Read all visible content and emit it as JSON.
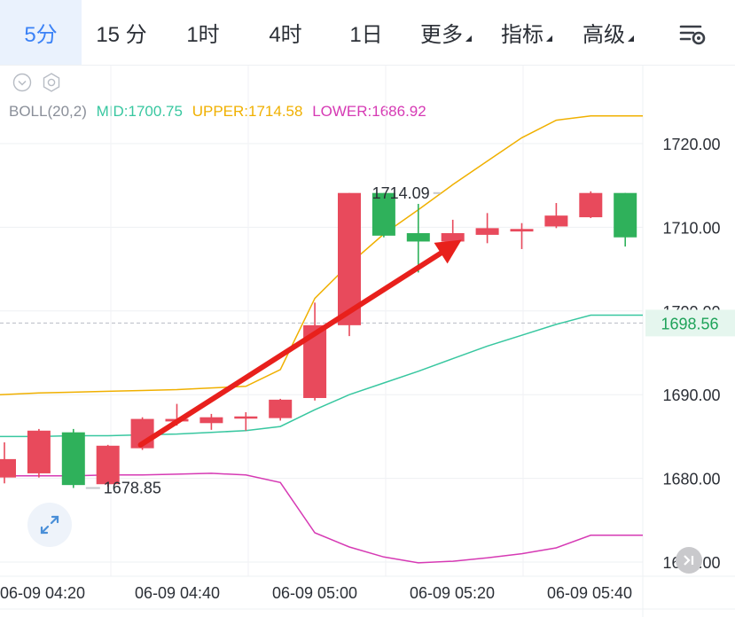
{
  "tabs": [
    {
      "label": "5分",
      "active": true
    },
    {
      "label": "15 分",
      "active": false
    },
    {
      "label": "1时",
      "active": false
    },
    {
      "label": "4时",
      "active": false
    },
    {
      "label": "1日",
      "active": false
    },
    {
      "label": "更多",
      "active": false,
      "dropdown": true
    },
    {
      "label": "指标",
      "active": false,
      "dropdown": true
    },
    {
      "label": "高级",
      "active": false,
      "dropdown": true
    }
  ],
  "toolbar": {
    "settings_icon": "chart-settings-icon"
  },
  "chart_controls": {
    "collapse_icon": "chevron-down-circle-icon",
    "indicator_settings_icon": "hexagon-gear-icon",
    "expand_icon": "expand-arrows-icon",
    "scroll_icon": "scroll-end-icon"
  },
  "indicator": {
    "name": "BOLL(20,2)",
    "mid_label": "MID:1700.75",
    "upper_label": "UPPER:1714.58",
    "lower_label": "LOWER:1686.92"
  },
  "colors": {
    "up": "#e84a5c",
    "down": "#2fb15b",
    "mid": "#38c7a0",
    "upper": "#f0b000",
    "lower": "#d63ab4",
    "arrow": "#e8201c",
    "accent": "#3b82f6"
  },
  "chart_data": {
    "type": "candlestick",
    "y_axis": {
      "range": [
        1666.5,
        1724
      ],
      "ticks": [
        "1720.00",
        "1710.00",
        "1700.00",
        "1690.00",
        "1680.00",
        "1670.00"
      ],
      "tick_values": [
        1720,
        1710,
        1700,
        1690,
        1680,
        1670
      ]
    },
    "x_axis": {
      "labels": [
        "06-09 04:20",
        "06-09 04:40",
        "06-09 05:00",
        "06-09 05:20",
        "06-09 05:40"
      ]
    },
    "current_price": "1698.56",
    "current_price_value": 1698.56,
    "high_marker": {
      "label": "1714.09",
      "value": 1714.09,
      "candle": 13
    },
    "low_marker": {
      "label": "1678.85",
      "value": 1678.85,
      "candle": 2
    },
    "candles": [
      {
        "open": 1680.1,
        "close": 1682.3,
        "high": 1684.3,
        "low": 1679.4
      },
      {
        "open": 1680.6,
        "close": 1685.7,
        "high": 1685.9,
        "low": 1680.1
      },
      {
        "open": 1685.5,
        "close": 1679.2,
        "high": 1685.9,
        "low": 1678.85
      },
      {
        "open": 1679.3,
        "close": 1683.9,
        "high": 1684.0,
        "low": 1679.0
      },
      {
        "open": 1683.6,
        "close": 1687.1,
        "high": 1687.3,
        "low": 1683.4
      },
      {
        "open": 1686.8,
        "close": 1687.1,
        "high": 1688.9,
        "low": 1686.3
      },
      {
        "open": 1686.6,
        "close": 1687.3,
        "high": 1687.7,
        "low": 1685.8
      },
      {
        "open": 1687.3,
        "close": 1687.4,
        "high": 1687.9,
        "low": 1685.7
      },
      {
        "open": 1687.2,
        "close": 1689.4,
        "high": 1689.5,
        "low": 1686.9
      },
      {
        "open": 1689.6,
        "close": 1698.3,
        "high": 1701.0,
        "low": 1689.3
      },
      {
        "open": 1698.3,
        "close": 1714.1,
        "high": 1714.1,
        "low": 1697.0
      },
      {
        "open": 1714.1,
        "close": 1709.0,
        "high": 1714.1,
        "low": 1708.8
      },
      {
        "open": 1709.3,
        "close": 1708.3,
        "high": 1712.8,
        "low": 1704.6
      },
      {
        "open": 1708.3,
        "close": 1709.3,
        "high": 1710.9,
        "low": 1708.0
      },
      {
        "open": 1709.1,
        "close": 1709.9,
        "high": 1711.7,
        "low": 1708.1
      },
      {
        "open": 1709.5,
        "close": 1709.8,
        "high": 1710.5,
        "low": 1707.4
      },
      {
        "open": 1710.1,
        "close": 1711.4,
        "high": 1712.9,
        "low": 1709.9
      },
      {
        "open": 1711.2,
        "close": 1714.1,
        "high": 1714.3,
        "low": 1711.1
      },
      {
        "open": 1714.1,
        "close": 1708.8,
        "high": 1714.1,
        "low": 1707.7
      }
    ],
    "series": [
      {
        "name": "MID",
        "values": [
          1685.0,
          1685.0,
          1685.1,
          1685.1,
          1685.2,
          1685.3,
          1685.5,
          1685.7,
          1686.2,
          1688.2,
          1690.0,
          1691.4,
          1692.8,
          1694.3,
          1695.8,
          1697.1,
          1698.4,
          1699.5
        ]
      },
      {
        "name": "UPPER",
        "values": [
          1690.0,
          1690.2,
          1690.3,
          1690.4,
          1690.5,
          1690.6,
          1690.8,
          1691.0,
          1693.0,
          1701.5,
          1705.6,
          1709.2,
          1712.1,
          1715.1,
          1717.9,
          1720.7,
          1722.8,
          1723.3
        ]
      },
      {
        "name": "LOWER",
        "values": [
          1680.3,
          1680.3,
          1680.3,
          1680.4,
          1680.4,
          1680.5,
          1680.6,
          1680.4,
          1679.5,
          1673.5,
          1671.8,
          1670.6,
          1669.9,
          1670.1,
          1670.5,
          1671.0,
          1671.7,
          1673.2
        ]
      }
    ],
    "annotation": {
      "type": "arrow",
      "from": {
        "candle": 4,
        "price": 1684.0
      },
      "to": {
        "candle": 13,
        "price": 1708.5
      }
    }
  }
}
